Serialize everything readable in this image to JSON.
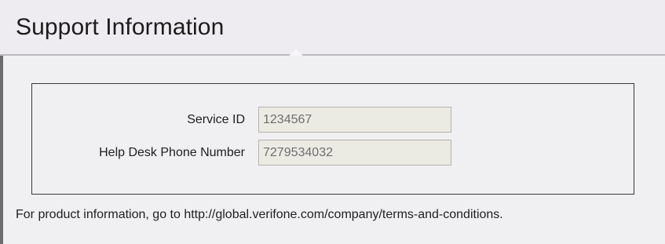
{
  "header": {
    "title": "Support Information"
  },
  "form": {
    "fields": [
      {
        "label": "Service ID",
        "value": "1234567"
      },
      {
        "label": "Help Desk Phone Number",
        "value": "7279534032"
      }
    ]
  },
  "footer": {
    "text": "For product information, go to http://global.verifone.com/company/terms-and-conditions."
  },
  "colors": {
    "header_background": "#eeecf0",
    "content_background": "#f0eff1",
    "input_background": "#ebebe4",
    "input_text": "#6e6e6e",
    "left_accent_border": "#6b6b6b"
  }
}
